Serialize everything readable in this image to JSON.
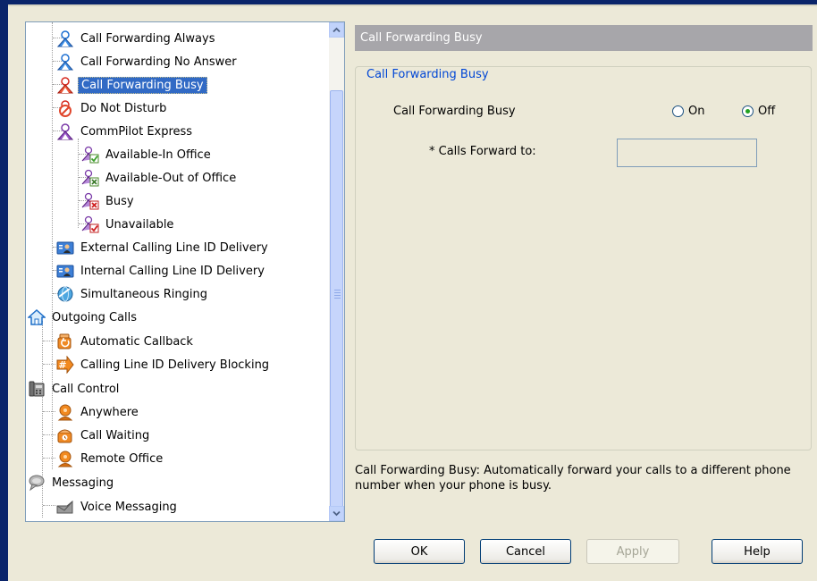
{
  "tree": {
    "items": [
      {
        "label": "Call Forwarding Always",
        "icon": "person-blue-icon"
      },
      {
        "label": "Call Forwarding No Answer",
        "icon": "person-blue-icon"
      },
      {
        "label": "Call Forwarding Busy",
        "icon": "person-red-icon",
        "selected": true
      },
      {
        "label": "Do Not Disturb",
        "icon": "do-not-disturb-icon"
      },
      {
        "label": "CommPilot Express",
        "icon": "person-purple-icon"
      },
      {
        "label": "Available-In Office",
        "icon": "available-in-office-icon"
      },
      {
        "label": "Available-Out of Office",
        "icon": "available-out-office-icon"
      },
      {
        "label": "Busy",
        "icon": "busy-icon"
      },
      {
        "label": "Unavailable",
        "icon": "unavailable-icon"
      },
      {
        "label": "External Calling Line ID Delivery",
        "icon": "id-card-icon"
      },
      {
        "label": "Internal Calling Line ID Delivery",
        "icon": "id-card-icon"
      },
      {
        "label": "Simultaneous Ringing",
        "icon": "globe-icon"
      },
      {
        "label": "Outgoing Calls",
        "icon": "house-icon"
      },
      {
        "label": "Automatic Callback",
        "icon": "phone-callback-icon"
      },
      {
        "label": "Calling Line ID Delivery Blocking",
        "icon": "hash-arrow-icon"
      },
      {
        "label": "Call Control",
        "icon": "phone-handset-icon"
      },
      {
        "label": "Anywhere",
        "icon": "person-orange-icon"
      },
      {
        "label": "Call Waiting",
        "icon": "phone-waiting-icon"
      },
      {
        "label": "Remote Office",
        "icon": "person-orange-icon"
      },
      {
        "label": "Messaging",
        "icon": "speech-bubble-icon"
      },
      {
        "label": "Voice Messaging",
        "icon": "envelope-icon"
      }
    ]
  },
  "panel": {
    "header": "Call Forwarding Busy",
    "group_title": "Call Forwarding Busy",
    "setting_label": "Call Forwarding Busy",
    "radio_on": "On",
    "radio_off": "Off",
    "selected_option": "Off",
    "forward_label": "* Calls Forward to:",
    "forward_value": "",
    "description": "Call Forwarding Busy: Automatically forward your calls to a different phone number when your phone is busy."
  },
  "buttons": {
    "ok": "OK",
    "cancel": "Cancel",
    "apply": "Apply",
    "help": "Help"
  },
  "colors": {
    "selection": "#316ac5",
    "header_bg": "#a7a6aa",
    "group_title": "#0046d5"
  }
}
